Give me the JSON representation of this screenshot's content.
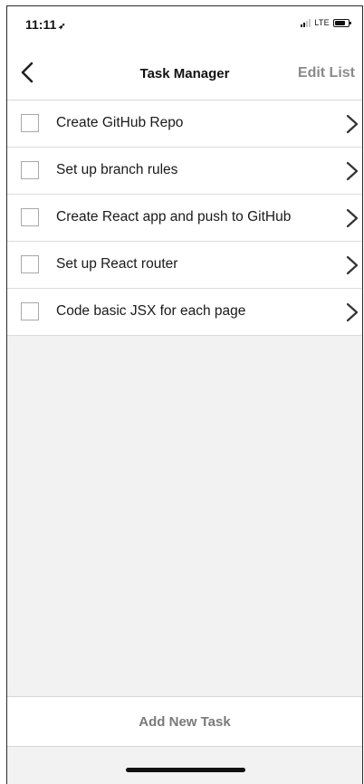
{
  "status_bar": {
    "time": "11:11",
    "location_glyph": "➶",
    "network": "LTE",
    "signal_bars_active": 2,
    "signal_bars_total": 4,
    "battery_level": 0.8
  },
  "nav": {
    "back_icon": "chevron-left-icon",
    "title": "Task Manager",
    "edit_label": "Edit List"
  },
  "tasks": [
    {
      "label": "Create GitHub Repo",
      "checked": false
    },
    {
      "label": "Set up branch rules",
      "checked": false
    },
    {
      "label": "Create React app and push to GitHub",
      "checked": false
    },
    {
      "label": "Set up React router",
      "checked": false
    },
    {
      "label": "Code basic JSX for each page",
      "checked": false
    }
  ],
  "footer": {
    "add_task_label": "Add New Task"
  },
  "colors": {
    "background": "#f2f2f2",
    "surface": "#ffffff",
    "text_primary": "#1a1a1a",
    "text_muted": "#8a8a8a",
    "divider": "#dcdcdc"
  }
}
